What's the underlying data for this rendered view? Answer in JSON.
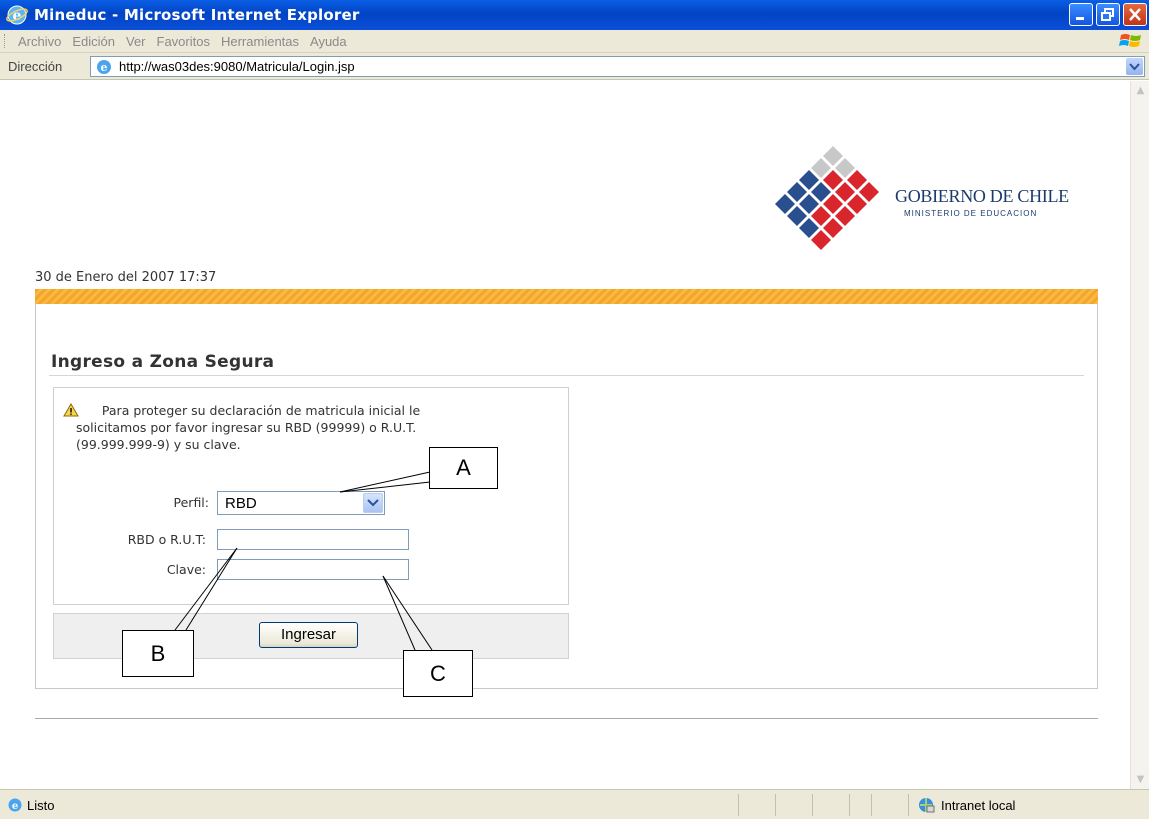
{
  "window": {
    "title": "Mineduc - Microsoft Internet Explorer",
    "icon": "ie-icon",
    "controls": [
      "minimize-icon",
      "restore-icon",
      "close-icon"
    ]
  },
  "menu": {
    "items": [
      "Archivo",
      "Edición",
      "Ver",
      "Favoritos",
      "Herramientas",
      "Ayuda"
    ]
  },
  "address": {
    "label": "Dirección",
    "url": "http://was03des:9080/Matricula/Login.jsp"
  },
  "header": {
    "logo_title": "GOBIERNO DE CHILE",
    "logo_subtitle": "MINISTERIO DE EDUCACION",
    "datetime": "30 de Enero del 2007 17:37"
  },
  "login": {
    "title": "Ingreso a Zona Segura",
    "notice_line1": "Para proteger su declaración de matricula inicial le",
    "notice_line2": "solicitamos por favor ingresar su RBD (99999) o R.U.T.",
    "notice_line3": "(99.999.999-9) y su clave.",
    "perfil_label": "Perfil:",
    "perfil_value": "RBD",
    "rut_label": "RBD o R.U.T:",
    "rut_value": "",
    "clave_label": "Clave:",
    "clave_value": "",
    "submit_label": "Ingresar"
  },
  "annotations": {
    "a": "A",
    "b": "B",
    "c": "C"
  },
  "status": {
    "text": "Listo",
    "zone": "Intranet local"
  },
  "colors": {
    "titlebar": "#0a5ee6",
    "accent_orange": "#f5a623",
    "brand_blue": "#1c3b6b",
    "brand_red": "#d9262d"
  }
}
